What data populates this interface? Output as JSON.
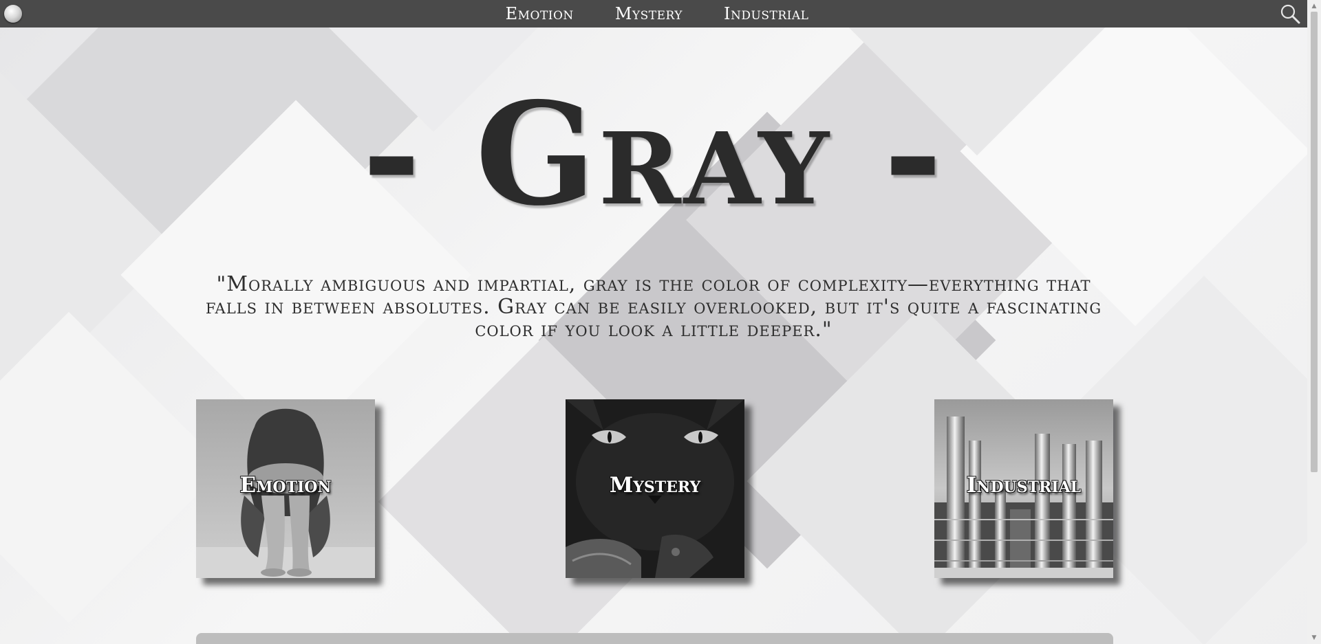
{
  "nav": {
    "items": [
      {
        "label": "Emotion"
      },
      {
        "label": "Mystery"
      },
      {
        "label": "Industrial"
      }
    ],
    "menu_icon": "menu-orb-icon",
    "search_icon": "magnifier-search-icon"
  },
  "hero": {
    "title": "- Gray -",
    "quote": "\"Morally ambiguous and impartial, gray is the color of complexity—everything that falls in between absolutes. Gray can be easily overlooked, but it's quite a fascinating color if you look a little deeper.\""
  },
  "tiles": [
    {
      "label": "Emotion",
      "image_subject": "woman hugging knees"
    },
    {
      "label": "Mystery",
      "image_subject": "black cat eyes"
    },
    {
      "label": "Industrial",
      "image_subject": "refinery towers"
    }
  ],
  "colors": {
    "nav_bg": "#4a4a4a",
    "title": "#2b2b2b",
    "text": "#2e2e2e"
  }
}
